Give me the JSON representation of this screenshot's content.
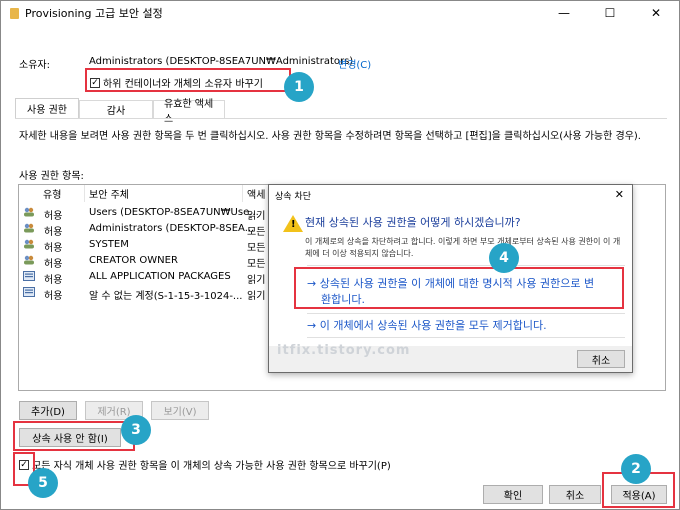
{
  "window": {
    "title": "Provisioning 고급 보안 설정",
    "minimize": "—",
    "maximize": "☐",
    "close": "✕"
  },
  "owner": {
    "label": "소유자:",
    "value": "Administrators (DESKTOP-8SEA7UN₩Administrators)",
    "change": "변경(C)"
  },
  "replace_owner_checkbox": {
    "label": "하위 컨테이너와 개체의 소유자 바꾸기",
    "checked": true
  },
  "tabs": [
    "사용 권한",
    "감사",
    "유효한 액세스"
  ],
  "description": "자세한 내용을 보려면 사용 권한 항목을 두 번 클릭하십시오. 사용 권한 항목을 수정하려면 항목을 선택하고 [편집]을 클릭하십시오(사용 가능한 경우).",
  "list": {
    "label": "사용 권한 항목:",
    "columns": [
      "유형",
      "보안 주체",
      "액세"
    ],
    "rows": [
      {
        "type": "허용",
        "principal": "Users (DESKTOP-8SEA7UN₩Use...",
        "access": "읽기"
      },
      {
        "type": "허용",
        "principal": "Administrators (DESKTOP-8SEA...",
        "access": "모든"
      },
      {
        "type": "허용",
        "principal": "SYSTEM",
        "access": "모든"
      },
      {
        "type": "허용",
        "principal": "CREATOR OWNER",
        "access": "모든"
      },
      {
        "type": "허용",
        "principal": "ALL APPLICATION PACKAGES",
        "access": "읽기"
      },
      {
        "type": "허용",
        "principal": "알 수 없는 계정(S-1-15-3-1024-...",
        "access": "읽기"
      }
    ]
  },
  "buttons": {
    "add": "추가(D)",
    "remove": "제거(R)",
    "view": "보기(V)",
    "disable_inheritance": "상속 사용 안 함(I)",
    "ok": "확인",
    "cancel": "취소",
    "apply": "적용(A)"
  },
  "inherit_checkbox": {
    "label": "모든 자식 개체 사용 권한 항목을 이 개체의 상속 가능한 사용 권한 항목으로 바꾸기(P)",
    "checked": true
  },
  "dialog": {
    "title": "상속 차단",
    "close": "✕",
    "heading": "현재 상속된 사용 권한을 어떻게 하시겠습니까?",
    "body": "이 개체로의 상속을 차단하려고 합니다. 이렇게 하면 부모 개체로부터 상속된 사용 권한이 이 개체에 더 이상 적용되지 않습니다.",
    "option1_line1": "→ 상속된 사용 권한을 이 개체에 대한 명시적 사용 권한으로 변",
    "option1_line2": "환합니다.",
    "option2": "→ 이 개체에서 상속된 사용 권한을 모두 제거합니다.",
    "cancel": "취소"
  },
  "watermark": "itfix.tistory.com",
  "badges": [
    "1",
    "2",
    "3",
    "4",
    "5"
  ],
  "colors": {
    "highlight": "#e53340",
    "badge": "#27a4c7",
    "link": "#1c57c8"
  }
}
